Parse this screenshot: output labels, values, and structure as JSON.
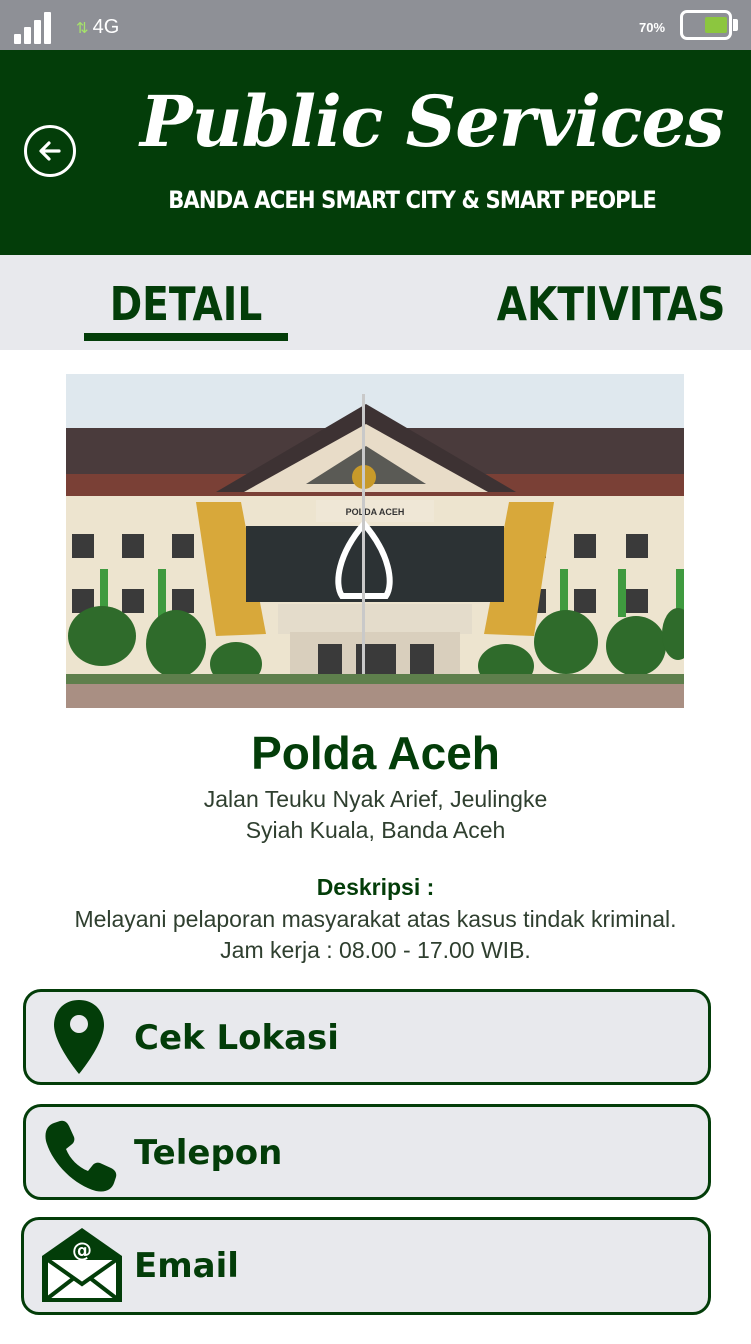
{
  "status_bar": {
    "network": "4G",
    "battery": "70%"
  },
  "header": {
    "title": "Public Services",
    "subtitle": "BANDA ACEH SMART CITY & SMART PEOPLE",
    "back_icon": "arrow-left-circle-icon",
    "background_color": "#033d09"
  },
  "tabs": [
    {
      "label": "DETAIL",
      "active": true
    },
    {
      "label": "AKTIVITAS",
      "active": false
    }
  ],
  "place": {
    "photo_sign": "POLDA ACEH",
    "name": "Polda Aceh",
    "address_line1": "Jalan Teuku Nyak Arief, Jeulingke",
    "address_line2": "Syiah Kuala, Banda Aceh"
  },
  "description": {
    "label": "Deskripsi :",
    "text_line1": "Melayani pelaporan masyarakat atas kasus tindak kriminal.",
    "text_line2": "Jam kerja : 08.00 - 17.00 WIB."
  },
  "actions": [
    {
      "label": "Cek Lokasi",
      "icon": "map-pin-icon"
    },
    {
      "label": "Telepon",
      "icon": "phone-icon"
    },
    {
      "label": "Email",
      "icon": "envelope-icon"
    }
  ]
}
